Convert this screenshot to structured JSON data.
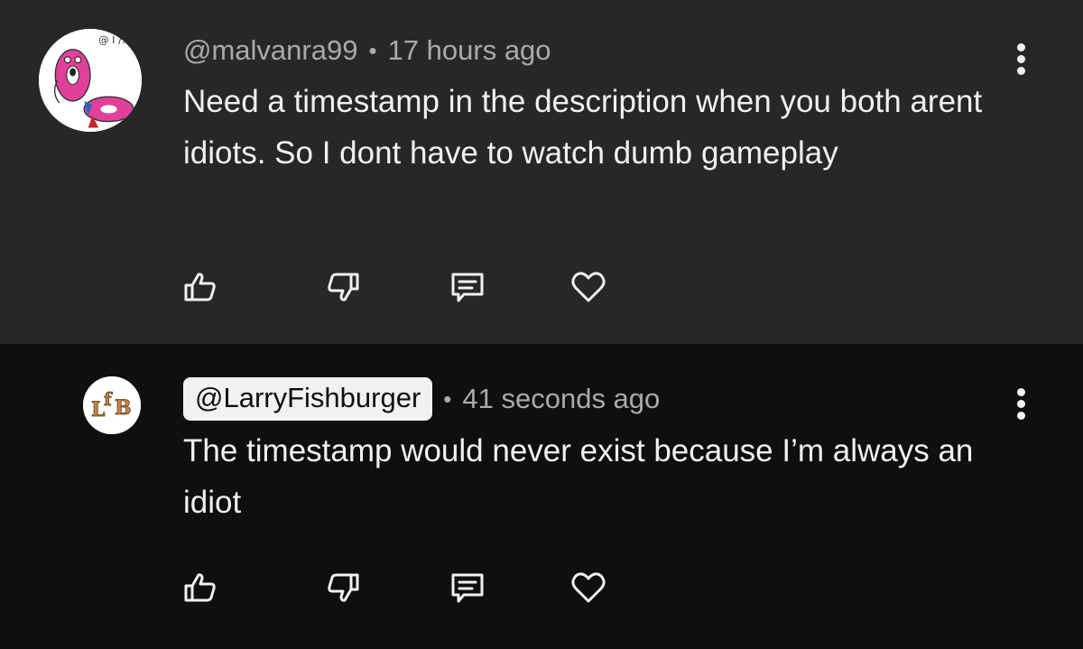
{
  "comments": [
    {
      "author": "@malvanra99",
      "separator": "•",
      "time": "17 hours ago",
      "text": "Need a timestamp in the description when you both arent idiots. So I dont have to watch dumb gameplay",
      "avatar": "cartoon-donut-avatar",
      "author_highlighted": false
    },
    {
      "author": "@LarryFishburger",
      "separator": "•",
      "time": "41 seconds ago",
      "text": "The timestamp would never exist because I’m always an idiot",
      "avatar": "lfb-logo-avatar",
      "author_highlighted": true
    }
  ],
  "actions": [
    "thumbs-up-icon",
    "thumbs-down-icon",
    "reply-icon",
    "heart-icon"
  ],
  "colors": {
    "highlighted_background": "#272727",
    "background": "#0f0f0f",
    "text": "#f1f1f1",
    "secondary_text": "#aaaaaa"
  }
}
